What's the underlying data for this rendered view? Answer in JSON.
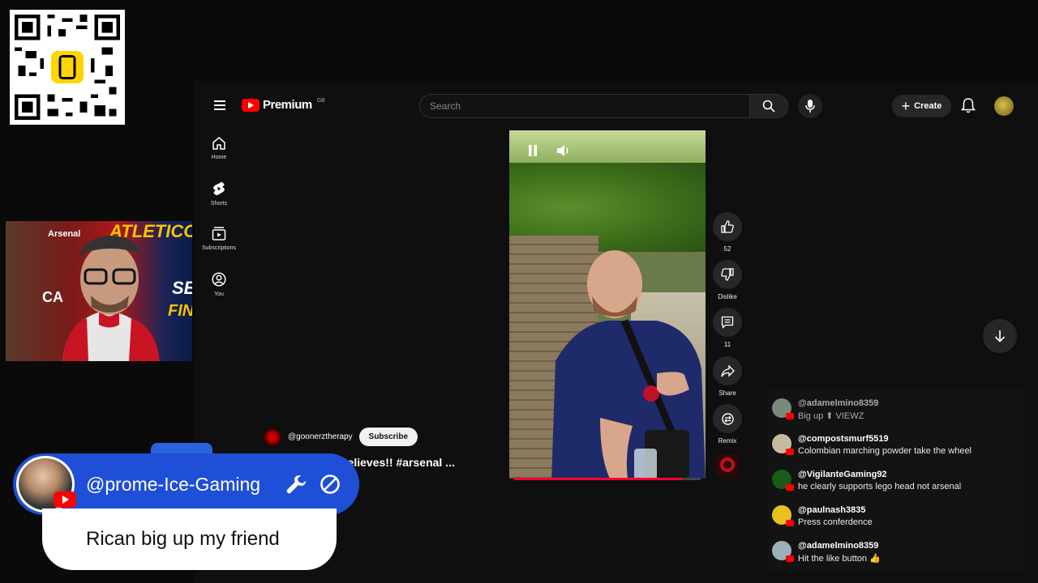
{
  "header": {
    "logo_word": "Premium",
    "region": "GB",
    "search_placeholder": "Search",
    "create_label": "Create"
  },
  "nav": [
    {
      "label": "Home",
      "icon": "home-icon"
    },
    {
      "label": "Shorts",
      "icon": "shorts-icon"
    },
    {
      "label": "Subscriptions",
      "icon": "subscriptions-icon"
    },
    {
      "label": "You",
      "icon": "you-icon"
    }
  ],
  "short": {
    "channel": "@goonerztherapy",
    "subscribe_label": "Subscribe",
    "title": "believes!! #arsenal ...",
    "progress": 0.9,
    "actions": {
      "likes": "52",
      "dislike_label": "Dislike",
      "comments": "11",
      "share_label": "Share",
      "remix_label": "Remix"
    }
  },
  "chat": [
    {
      "name": "@adamelmino8359",
      "text": "Big up ⬆ VIEWZ",
      "color": "#7a8a7a",
      "faded": true
    },
    {
      "name": "@compostsmurf5519",
      "text": "Colombian marching powder take the wheel",
      "color": "#c9b8a0",
      "faded": false
    },
    {
      "name": "@VigilanteGaming92",
      "text": "he clearly supports lego head not arsenal",
      "color": "#1a5a1a",
      "faded": false
    },
    {
      "name": "@paulnash3835",
      "text": "Press conferdence",
      "color": "#e8c21a",
      "faded": false
    },
    {
      "name": "@adamelmino8359",
      "text": "Hit the like button 👍",
      "color": "#9bb0b8",
      "faded": false
    }
  ],
  "webcam": {
    "thumb_words": [
      "ATLETICO",
      "SE",
      "FINA",
      "Arsenal",
      "CA"
    ]
  },
  "alert": {
    "username": "@prome-Ice-Gaming",
    "message": "Rican big up my friend"
  },
  "colors": {
    "accent": "#ff0033",
    "alert_blue": "#1f4fd6",
    "bg": "#0f0f0f"
  }
}
